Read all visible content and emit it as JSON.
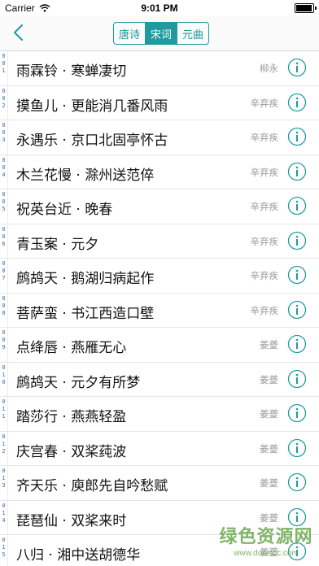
{
  "status_bar": {
    "carrier": "Carrier",
    "time": "9:01 PM",
    "battery_level": 0.95
  },
  "nav": {
    "back_icon": "chevron-left-icon",
    "tabs": [
      {
        "label": "唐诗",
        "active": false
      },
      {
        "label": "宋词",
        "active": true
      },
      {
        "label": "元曲",
        "active": false
      }
    ]
  },
  "accent_color": "#1f9a9e",
  "list": {
    "items": [
      {
        "index": [
          "0",
          "0",
          "1"
        ],
        "title": "雨霖铃 · 寒蝉凄切",
        "author": "柳永"
      },
      {
        "index": [
          "0",
          "0",
          "2"
        ],
        "title": "摸鱼儿 · 更能消几番风雨",
        "author": "辛弃疾"
      },
      {
        "index": [
          "0",
          "0",
          "3"
        ],
        "title": "永遇乐 · 京口北固亭怀古",
        "author": "辛弃疾"
      },
      {
        "index": [
          "0",
          "0",
          "4"
        ],
        "title": "木兰花慢 · 滁州送范倅",
        "author": "辛弃疾"
      },
      {
        "index": [
          "0",
          "0",
          "5"
        ],
        "title": "祝英台近 · 晚春",
        "author": "辛弃疾"
      },
      {
        "index": [
          "0",
          "0",
          "6"
        ],
        "title": "青玉案 · 元夕",
        "author": "辛弃疾"
      },
      {
        "index": [
          "0",
          "0",
          "7"
        ],
        "title": "鹧鸪天 · 鹅湖归病起作",
        "author": "辛弃疾"
      },
      {
        "index": [
          "0",
          "0",
          "8"
        ],
        "title": "菩萨蛮 · 书江西造口壁",
        "author": "辛弃疾"
      },
      {
        "index": [
          "0",
          "0",
          "9"
        ],
        "title": "点绛唇 · 燕雁无心",
        "author": "姜夔"
      },
      {
        "index": [
          "0",
          "1",
          "0"
        ],
        "title": "鹧鸪天 · 元夕有所梦",
        "author": "姜夔"
      },
      {
        "index": [
          "0",
          "1",
          "1"
        ],
        "title": "踏莎行 · 燕燕轻盈",
        "author": "姜夔"
      },
      {
        "index": [
          "0",
          "1",
          "2"
        ],
        "title": "庆宫春 · 双桨莼波",
        "author": "姜夔"
      },
      {
        "index": [
          "0",
          "1",
          "3"
        ],
        "title": "齐天乐 · 庾郎先自吟愁赋",
        "author": "姜夔"
      },
      {
        "index": [
          "0",
          "1",
          "4"
        ],
        "title": "琵琶仙 · 双桨来时",
        "author": "姜夔"
      },
      {
        "index": [
          "0",
          "1",
          "5"
        ],
        "title": "八归 · 湘中送胡德华",
        "author": "姜夔"
      }
    ],
    "info_icon": "info-circle-icon"
  },
  "watermark": {
    "text": "绿色资源网",
    "url": "www.downcc.com"
  }
}
